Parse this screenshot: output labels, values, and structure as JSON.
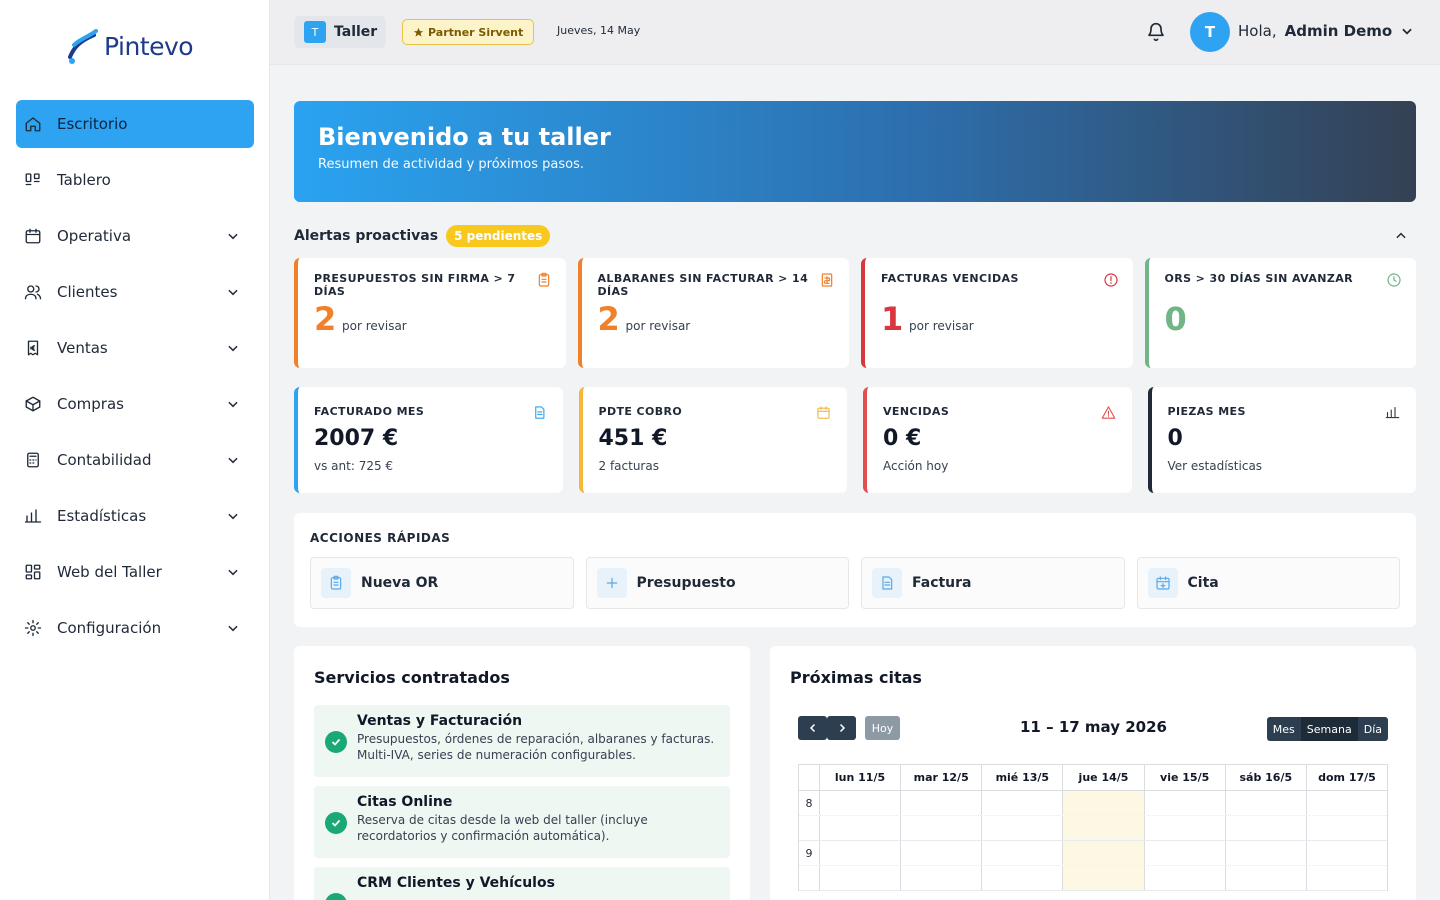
{
  "brand": {
    "name": "Pintevo"
  },
  "sidebar": {
    "items": [
      {
        "label": "Escritorio",
        "icon": "home-icon",
        "active": true,
        "has_submenu": false
      },
      {
        "label": "Tablero",
        "icon": "kanban-icon",
        "active": false,
        "has_submenu": false
      },
      {
        "label": "Operativa",
        "icon": "calendar-icon",
        "active": false,
        "has_submenu": true
      },
      {
        "label": "Clientes",
        "icon": "users-icon",
        "active": false,
        "has_submenu": true
      },
      {
        "label": "Ventas",
        "icon": "invoice-euro-icon",
        "active": false,
        "has_submenu": true
      },
      {
        "label": "Compras",
        "icon": "box-icon",
        "active": false,
        "has_submenu": true
      },
      {
        "label": "Contabilidad",
        "icon": "calculator-icon",
        "active": false,
        "has_submenu": true
      },
      {
        "label": "Estadísticas",
        "icon": "bar-chart-icon",
        "active": false,
        "has_submenu": true
      },
      {
        "label": "Web del Taller",
        "icon": "layout-icon",
        "active": false,
        "has_submenu": true
      },
      {
        "label": "Configuración",
        "icon": "gear-icon",
        "active": false,
        "has_submenu": true
      }
    ]
  },
  "topbar": {
    "workshop_initial": "T",
    "workshop_label": "Taller",
    "partner_label": "Partner Sirvent",
    "date": "Jueves, 14 May",
    "avatar_initial": "T",
    "greeting": "Hola,",
    "user_name": "Admin Demo"
  },
  "hero": {
    "title": "Bienvenido a tu taller",
    "subtitle": "Resumen de actividad y próximos pasos."
  },
  "alerts": {
    "title": "Alertas proactivas",
    "badge": "5 pendientes",
    "cards": [
      {
        "title": "PRESUPUESTOS SIN FIRMA > 7 DÍAS",
        "count": "2",
        "sub": "por revisar",
        "color": "#f0802a",
        "icon": "clipboard-icon"
      },
      {
        "title": "ALBARANES SIN FACTURAR > 14 DÍAS",
        "count": "2",
        "sub": "por revisar",
        "color": "#f0802a",
        "icon": "receipt-icon"
      },
      {
        "title": "FACTURAS VENCIDAS",
        "count": "1",
        "sub": "por revisar",
        "color": "#d9363e",
        "icon": "alert-circle-icon"
      },
      {
        "title": "ORS > 30 DÍAS SIN AVANZAR",
        "count": "0",
        "sub": "",
        "color": "#6fb585",
        "icon": "clock-icon"
      }
    ]
  },
  "kpis": [
    {
      "title": "FACTURADO MES",
      "value": "2007 €",
      "sub": "vs ant: 725 €",
      "color": "#2ea3f2",
      "icon": "document-icon"
    },
    {
      "title": "PDTE COBRO",
      "value": "451 €",
      "sub": "2 facturas",
      "color": "#f5b73b",
      "icon": "calendar-icon"
    },
    {
      "title": "VENCIDAS",
      "value": "0 €",
      "sub": "Acción hoy",
      "color": "#e24f4f",
      "icon": "warning-triangle-icon"
    },
    {
      "title": "PIEZAS MES",
      "value": "0",
      "sub": "Ver estadísticas",
      "color": "#1f2937",
      "icon": "bar-chart-icon"
    }
  ],
  "quick_actions": {
    "title": "ACCIONES RÁPIDAS",
    "items": [
      {
        "label": "Nueva OR",
        "icon": "clipboard-icon"
      },
      {
        "label": "Presupuesto",
        "icon": "plus-icon"
      },
      {
        "label": "Factura",
        "icon": "document-icon"
      },
      {
        "label": "Cita",
        "icon": "calendar-plus-icon"
      }
    ]
  },
  "services": {
    "title": "Servicios contratados",
    "items": [
      {
        "name": "Ventas y Facturación",
        "desc": "Presupuestos, órdenes de reparación, albaranes y facturas. Multi-IVA, series de numeración configurables."
      },
      {
        "name": "Citas Online",
        "desc": "Reserva de citas desde la web del taller (incluye recordatorios y confirmación automática)."
      },
      {
        "name": "CRM Clientes y Vehículos",
        "desc": ""
      }
    ]
  },
  "calendar": {
    "title": "Próximas citas",
    "today_button": "Hoy",
    "range": "11 – 17 may 2026",
    "views": [
      "Mes",
      "Semana",
      "Día"
    ],
    "active_view": "Semana",
    "days": [
      "lun 11/5",
      "mar 12/5",
      "mié 13/5",
      "jue 14/5",
      "vie 15/5",
      "sáb 16/5",
      "dom 17/5"
    ],
    "today_index": 3,
    "hours": [
      "8",
      "9"
    ]
  },
  "colors": {
    "accent": "#2ea3f2",
    "dark": "#2c3e50"
  }
}
